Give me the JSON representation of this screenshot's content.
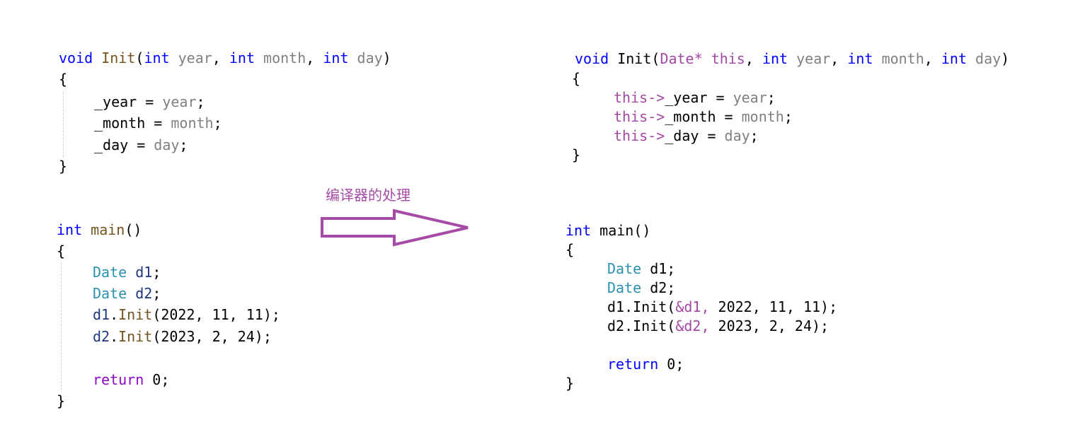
{
  "colors": {
    "kw": "#0000ff",
    "fn": "#74531f",
    "param": "#808080",
    "type": "#2b91af",
    "var": "#1f377f",
    "ret": "#8f08c4",
    "txt": "#000000",
    "this": "#a349a4",
    "accent": "#a64ca6"
  },
  "annotation": "编译器的处理",
  "left": {
    "init": [
      [
        [
          "void ",
          "kw"
        ],
        [
          "Init",
          "fn"
        ],
        [
          "(",
          "txt"
        ],
        [
          "int ",
          "kw"
        ],
        [
          "year",
          "param"
        ],
        [
          ", ",
          "txt"
        ],
        [
          "int ",
          "kw"
        ],
        [
          "month",
          "param"
        ],
        [
          ", ",
          "txt"
        ],
        [
          "int ",
          "kw"
        ],
        [
          "day",
          "param"
        ],
        [
          ")",
          "txt"
        ]
      ],
      [
        [
          "{",
          "txt"
        ]
      ],
      [
        [
          "_year = ",
          "txt"
        ],
        [
          "year",
          "param"
        ],
        [
          ";",
          "txt"
        ]
      ],
      [
        [
          "_month = ",
          "txt"
        ],
        [
          "month",
          "param"
        ],
        [
          ";",
          "txt"
        ]
      ],
      [
        [
          "_day = ",
          "txt"
        ],
        [
          "day",
          "param"
        ],
        [
          ";",
          "txt"
        ]
      ],
      [
        [
          "}",
          "txt"
        ]
      ]
    ],
    "main": [
      [
        [
          "int ",
          "kw"
        ],
        [
          "main",
          "fn"
        ],
        [
          "()",
          "txt"
        ]
      ],
      [
        [
          "{",
          "txt"
        ]
      ],
      [
        [
          "Date ",
          "type"
        ],
        [
          "d1",
          "var"
        ],
        [
          ";",
          "txt"
        ]
      ],
      [
        [
          "Date ",
          "type"
        ],
        [
          "d2",
          "var"
        ],
        [
          ";",
          "txt"
        ]
      ],
      [
        [
          "d1",
          "var"
        ],
        [
          ".",
          "txt"
        ],
        [
          "Init",
          "fn"
        ],
        [
          "(2022, 11, 11);",
          "txt"
        ]
      ],
      [
        [
          "d2",
          "var"
        ],
        [
          ".",
          "txt"
        ],
        [
          "Init",
          "fn"
        ],
        [
          "(2023, 2, 24);",
          "txt"
        ]
      ],
      [
        [
          "return ",
          "ret"
        ],
        [
          "0;",
          "txt"
        ]
      ],
      [
        [
          "}",
          "txt"
        ]
      ]
    ]
  },
  "right": {
    "init": [
      [
        [
          "void ",
          "kw"
        ],
        [
          "Init",
          "txt"
        ],
        [
          "(",
          "txt"
        ],
        [
          "Date* ",
          "this"
        ],
        [
          "this",
          "this"
        ],
        [
          ", ",
          "txt"
        ],
        [
          "int ",
          "kw"
        ],
        [
          "year",
          "param"
        ],
        [
          ", ",
          "txt"
        ],
        [
          "int ",
          "kw"
        ],
        [
          "month",
          "param"
        ],
        [
          ", ",
          "txt"
        ],
        [
          "int ",
          "kw"
        ],
        [
          "day",
          "param"
        ],
        [
          ")",
          "txt"
        ]
      ],
      [
        [
          "{",
          "txt"
        ]
      ],
      [
        [
          "this->",
          "this"
        ],
        [
          "_year = ",
          "txt"
        ],
        [
          "year",
          "param"
        ],
        [
          ";",
          "txt"
        ]
      ],
      [
        [
          "this->",
          "this"
        ],
        [
          "_month = ",
          "txt"
        ],
        [
          "month",
          "param"
        ],
        [
          ";",
          "txt"
        ]
      ],
      [
        [
          "this->",
          "this"
        ],
        [
          "_day = ",
          "txt"
        ],
        [
          "day",
          "param"
        ],
        [
          ";",
          "txt"
        ]
      ],
      [
        [
          "}",
          "txt"
        ]
      ]
    ],
    "main": [
      [
        [
          "int ",
          "kw"
        ],
        [
          "main",
          "txt"
        ],
        [
          "()",
          "txt"
        ]
      ],
      [
        [
          "{",
          "txt"
        ]
      ],
      [
        [
          "Date ",
          "type"
        ],
        [
          "d1;",
          "txt"
        ]
      ],
      [
        [
          "Date ",
          "type"
        ],
        [
          "d2;",
          "txt"
        ]
      ],
      [
        [
          "d1.Init(",
          "txt"
        ],
        [
          "&d1, ",
          "this"
        ],
        [
          "2022, 11, 11);",
          "txt"
        ]
      ],
      [
        [
          "d2.Init(",
          "txt"
        ],
        [
          "&d2, ",
          "this"
        ],
        [
          "2023, 2, 24);",
          "txt"
        ]
      ],
      [
        [
          "return ",
          "kw"
        ],
        [
          "0;",
          "txt"
        ]
      ],
      [
        [
          "}",
          "txt"
        ]
      ]
    ]
  }
}
